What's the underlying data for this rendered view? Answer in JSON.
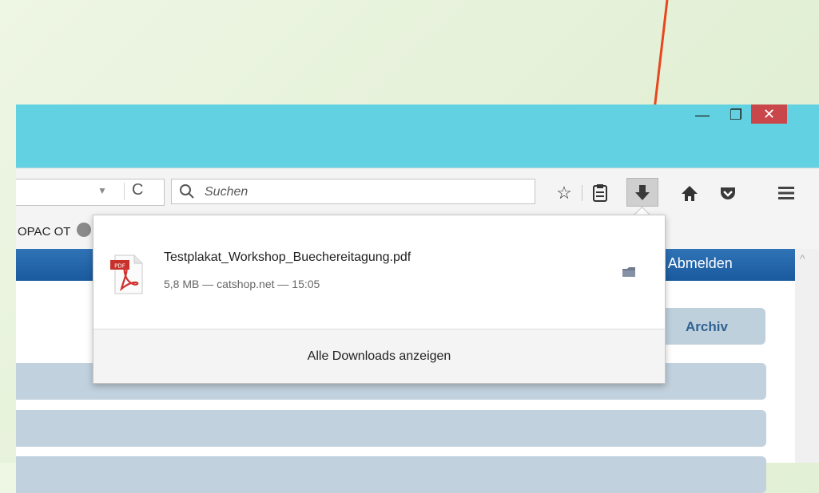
{
  "window": {
    "minimize_glyph": "—",
    "maximize_glyph": "❐",
    "close_glyph": "✕"
  },
  "toolbar": {
    "url_dropdown_glyph": "▼",
    "reload_glyph": "C",
    "search_placeholder": "Suchen",
    "star_glyph": "☆",
    "icons": [
      "search-icon",
      "bookmark-star-icon",
      "reading-list-icon",
      "download-icon",
      "home-icon",
      "pocket-icon",
      "hamburger-menu-icon"
    ]
  },
  "bookmarks": {
    "label": "OPAC OT"
  },
  "page": {
    "header_link": "o | Abmelden",
    "archive_button": "Archiv"
  },
  "downloads_panel": {
    "file_name": "Testplakat_Workshop_Buechereitagung.pdf",
    "file_meta": "5,8 MB — catshop.net — 15:05",
    "pdf_badge": "PDF",
    "show_all_label": "Alle Downloads anzeigen"
  },
  "colors": {
    "titlebar": "#62d2e2",
    "close_button": "#c9464b",
    "page_header": "#1f63a8",
    "annotation_arrow": "#e8461c"
  }
}
